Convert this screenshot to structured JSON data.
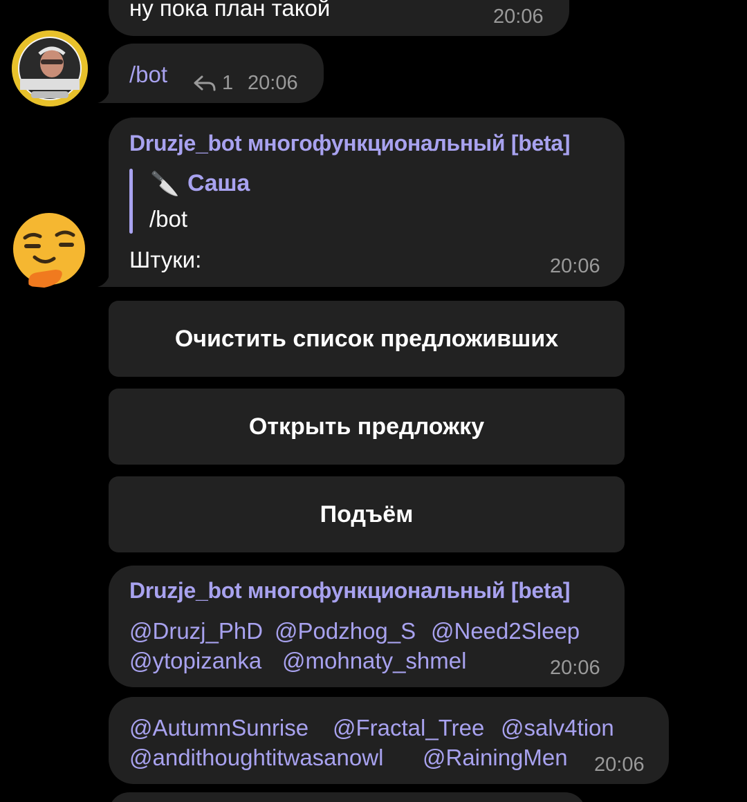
{
  "messages": [
    {
      "text": "ну пока план такой",
      "time": "20:06"
    },
    {
      "command": "/bot",
      "replies_count": "1",
      "time": "20:06"
    },
    {
      "sender": "Druzje_bot многофункциональный [beta]",
      "quote_emoji": "🔪",
      "quote_author": "Саша",
      "quote_text": "/bot",
      "text": "Штуки:",
      "time": "20:06"
    },
    {
      "sender": "Druzje_bot многофункциональный [beta]",
      "mentions": [
        "@Druzj_PhD",
        "@Podzhog_S",
        "@Need2Sleep",
        "@ytopizanka",
        "@mohnaty_shmel"
      ],
      "time": "20:06"
    },
    {
      "mentions": [
        "@AutumnSunrise",
        "@Fractal_Tree",
        "@salv4tion",
        "@andithoughtitwasanowl",
        "@RainingMen"
      ],
      "time": "20:06"
    }
  ],
  "keyboard": {
    "buttons": [
      "Очистить список предложивших",
      "Открыть предложку",
      "Подъём"
    ]
  },
  "colors": {
    "background": "#000000",
    "bubble": "#212121",
    "accent": "#a8a2ef",
    "time": "#9a9a9a"
  },
  "icons": {
    "reply": "reply-arrow-icon",
    "user_avatar": "user-avatar-photo",
    "bot_avatar": "thinking-face-emoji-avatar"
  }
}
